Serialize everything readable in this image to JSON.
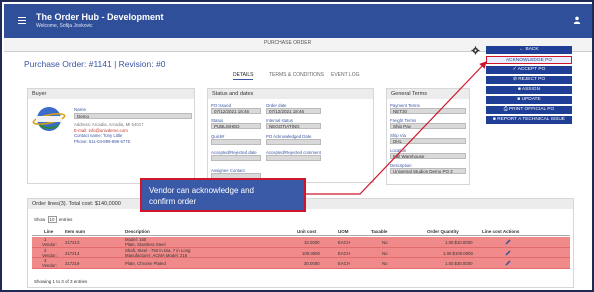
{
  "header": {
    "title": "The Order Hub - Development",
    "subtitle": "Welcome, Sofija Jovkovic"
  },
  "tab": "PURCHASE ORDER",
  "po": {
    "title": "Purchase Order: #1141 | Revision: #0"
  },
  "subtabs": [
    "DETAILS",
    "TERMS & CONDITIONS",
    "EVENT LOG"
  ],
  "buyer": {
    "heading": "Buyer",
    "name_label": "Name",
    "name_value": "Demo",
    "address": "Address: Arcadia, Arcadia, MI 54017",
    "email": "E-mail: info@univdemo.com",
    "contact": "Contact name: Tony Little",
    "phone": "Phone: 611-04-899-896-6775"
  },
  "status": {
    "heading": "Status and dates",
    "po_issued_label": "PO Issued",
    "po_issued_value": "07/12/2021 18:46",
    "order_date_label": "Order date",
    "order_date_value": "07/12/2021 18:46",
    "status_label": "Status",
    "status_value": "PUBLISHED",
    "internal_status_label": "Internal status",
    "internal_status_value": "NEGOTIATING",
    "quick_label": "Quick#",
    "ack_date_label": "PO Acknowledged Date",
    "accepted_date_label": "Accepted/Rejected date",
    "accepted_comment_label": "Accepted/Rejected comment",
    "assignee_label": "Assignee Contact"
  },
  "terms": {
    "heading": "General Terms",
    "payment_label": "Payment Terms",
    "payment_value": "NET30",
    "freight_label": "Freight Terms",
    "freight_value": "Ship Pay",
    "shipvia_label": "Ship Via",
    "shipvia_value": "DHL",
    "location_label": "Location",
    "location_value": "Fall Warehouse",
    "description_label": "Description",
    "description_value": "Universal Studios Demo PO 2"
  },
  "actions": [
    "BACK",
    "ACKNOWLEDGE PO",
    "ACCEPT PO",
    "REJECT PO",
    "ASSIGN",
    "UPDATE",
    "PRINT OFFICIAL PO",
    "REPORT A TECHNICAL ISSUE"
  ],
  "callout": {
    "line1": "Vendor can acknowledge and",
    "line2": "confirm order"
  },
  "lines": {
    "heading": "Order lines(3). Total cost: $140,0000",
    "show_prefix": "Show",
    "show_value": "10",
    "show_suffix": "entries",
    "columns": [
      "Line",
      "Item num",
      "Description",
      "Unit cost",
      "UOM",
      "Taxable",
      "Order Quantity",
      "Line cost Actions"
    ],
    "rows": [
      {
        "line": "1",
        "vendor": "Vendor:",
        "item": "217213",
        "desc1": "Model: 160",
        "desc2": "Plate, Stainless Steel",
        "unit": "10.0000",
        "uom": "EACH",
        "taxable": "No",
        "qty": "1.00 $10.0000"
      },
      {
        "line": "2",
        "vendor": "Vendor:",
        "item": "217214",
        "desc1": "Shaft, Steel - 750 in Dia, 7 in Long",
        "desc2": "Manufacturer: ACMA Model: 216",
        "unit": "100.0000",
        "uom": "EACH",
        "taxable": "No",
        "qty": "1.00 $100.0000"
      },
      {
        "line": "3",
        "vendor": "Vendor:",
        "item": "217219",
        "desc1": "Plate, Chrome Plated",
        "desc2": "",
        "unit": "30.0000",
        "uom": "EACH",
        "taxable": "No",
        "qty": "1.00 $30.0000"
      }
    ],
    "footer": "Showing 1 to 3 of 3 entries"
  }
}
